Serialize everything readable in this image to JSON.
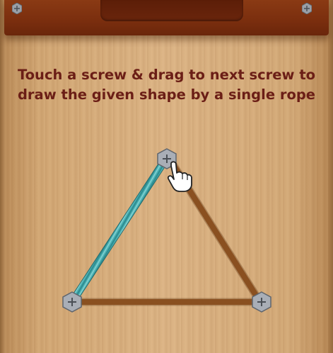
{
  "header": {
    "left_screw_icon": "hex-screw-icon",
    "right_screw_icon": "hex-screw-icon"
  },
  "instruction": {
    "line1": "Touch a screw & drag to next screw to",
    "line2": "draw the given shape by a single rope"
  },
  "puzzle": {
    "shape": "triangle",
    "screws": [
      {
        "id": "top",
        "icon": "hex-screw-icon"
      },
      {
        "id": "bottom-left",
        "icon": "hex-screw-icon"
      },
      {
        "id": "bottom-right",
        "icon": "hex-screw-icon"
      }
    ],
    "rope_drawn": [
      "top",
      "bottom-left"
    ],
    "hand_icon": "pointing-hand-icon",
    "colors": {
      "rope": "#4fb3b5",
      "guide_line": "#8a5020",
      "text": "#6b1e16",
      "top_bar": "#7a2e0e"
    }
  }
}
